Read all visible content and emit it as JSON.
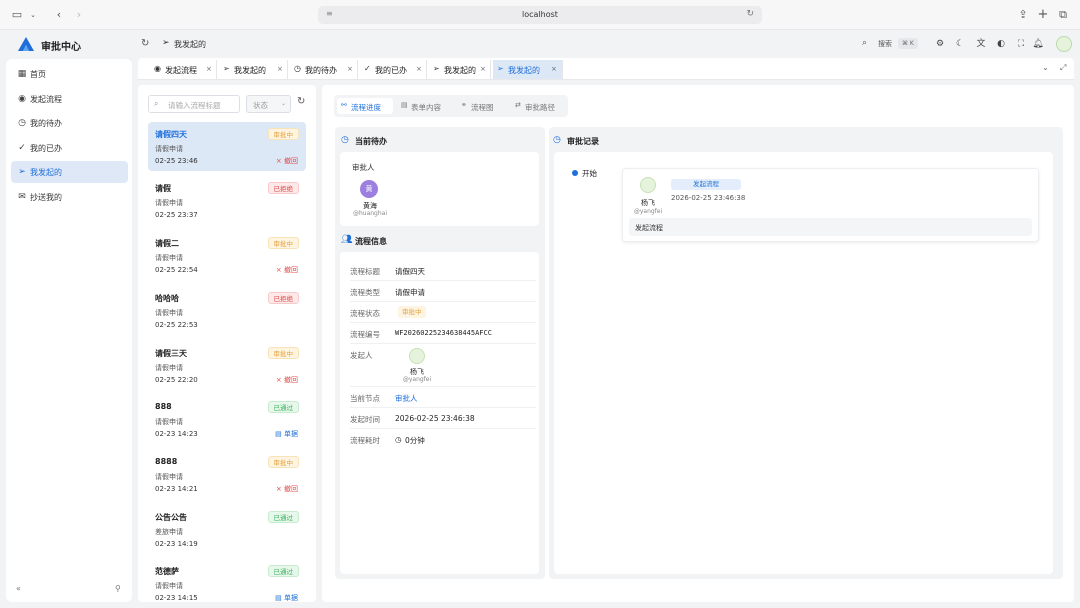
{
  "browser": {
    "url": "localhost"
  },
  "app": {
    "title": "审批中心",
    "breadcrumb": "我发起的",
    "search_label": "搜索",
    "search_shortcut": "⌘ K"
  },
  "sidebar": {
    "items": [
      {
        "label": "首页",
        "icon": "grid-icon"
      },
      {
        "label": "发起流程",
        "icon": "play-circle-icon"
      },
      {
        "label": "我的待办",
        "icon": "clock-icon"
      },
      {
        "label": "我的已办",
        "icon": "check-circle-icon"
      },
      {
        "label": "我发起的",
        "icon": "send-icon",
        "active": true
      },
      {
        "label": "抄送我的",
        "icon": "mail-icon"
      }
    ]
  },
  "tabs": [
    {
      "label": "发起流程",
      "icon": "play-circle-icon"
    },
    {
      "label": "我发起的",
      "icon": "send-icon"
    },
    {
      "label": "我的待办",
      "icon": "clock-icon"
    },
    {
      "label": "我的已办",
      "icon": "check-circle-icon"
    },
    {
      "label": "我发起的",
      "icon": "send-icon"
    },
    {
      "label": "我发起的",
      "icon": "send-icon",
      "active": true
    }
  ],
  "list": {
    "search_placeholder": "请输入流程标题",
    "status_placeholder": "状态",
    "items": [
      {
        "title": "请假四天",
        "type": "请假申请",
        "time": "02-25 23:46",
        "status": "审批中",
        "status_kind": "pending",
        "action": "× 撤回",
        "action_kind": "withdraw",
        "selected": true
      },
      {
        "title": "请假",
        "type": "请假申请",
        "time": "02-25 23:37",
        "status": "已拒绝",
        "status_kind": "rejected",
        "action": "",
        "action_kind": ""
      },
      {
        "title": "请假二",
        "type": "请假申请",
        "time": "02-25 22:54",
        "status": "审批中",
        "status_kind": "pending",
        "action": "× 撤回",
        "action_kind": "withdraw"
      },
      {
        "title": "哈哈哈",
        "type": "请假申请",
        "time": "02-25 22:53",
        "status": "已拒绝",
        "status_kind": "rejected",
        "action": "",
        "action_kind": ""
      },
      {
        "title": "请假三天",
        "type": "请假申请",
        "time": "02-25 22:20",
        "status": "审批中",
        "status_kind": "pending",
        "action": "× 撤回",
        "action_kind": "withdraw"
      },
      {
        "title": "888",
        "type": "请假申请",
        "time": "02-23 14:23",
        "status": "已通过",
        "status_kind": "approved",
        "action": "单据",
        "action_kind": "doc"
      },
      {
        "title": "8888",
        "type": "请假申请",
        "time": "02-23 14:21",
        "status": "审批中",
        "status_kind": "pending",
        "action": "× 撤回",
        "action_kind": "withdraw"
      },
      {
        "title": "公告公告",
        "type": "差旅申请",
        "time": "02-23 14:19",
        "status": "已通过",
        "status_kind": "approved",
        "action": "",
        "action_kind": ""
      },
      {
        "title": "范德萨",
        "type": "请假申请",
        "time": "02-23 14:15",
        "status": "已通过",
        "status_kind": "approved",
        "action": "单据",
        "action_kind": "doc"
      }
    ]
  },
  "detail": {
    "subtabs": [
      {
        "label": "流程进度",
        "icon": "flow-icon",
        "active": true
      },
      {
        "label": "表单内容",
        "icon": "doc-icon"
      },
      {
        "label": "流程图",
        "icon": "graph-icon"
      },
      {
        "label": "审批路径",
        "icon": "route-icon"
      }
    ],
    "pending": {
      "title": "当前待办",
      "approver_label": "审批人",
      "approver_avatar": "黄",
      "approver_name": "黄海",
      "approver_handle": "@huanghai"
    },
    "info": {
      "title": "流程信息",
      "rows": [
        {
          "key": "流程标题",
          "value": "请假四天"
        },
        {
          "key": "流程类型",
          "value": "请假申请"
        },
        {
          "key": "流程状态",
          "value": "审批中"
        },
        {
          "key": "流程编号",
          "value": "WF20260225234638445AFCC"
        },
        {
          "key": "发起人",
          "value": ""
        },
        {
          "key": "当前节点",
          "value": "审批人"
        },
        {
          "key": "发起时间",
          "value": "2026-02-25 23:46:38"
        },
        {
          "key": "流程耗时",
          "value": "0分钟"
        }
      ],
      "initiator_name": "杨飞",
      "initiator_handle": "@yangfei"
    },
    "records": {
      "title": "审批记录",
      "start_label": "开始",
      "user_name": "杨飞",
      "user_handle": "@yangfei",
      "action": "发起流程",
      "time": "2026-02-25 23:46:38",
      "comment": "发起流程"
    }
  },
  "colors": {
    "accent": "#1e6fd9",
    "pending": "#e6a23c",
    "rejected": "#e04949",
    "approved": "#38b25a"
  }
}
